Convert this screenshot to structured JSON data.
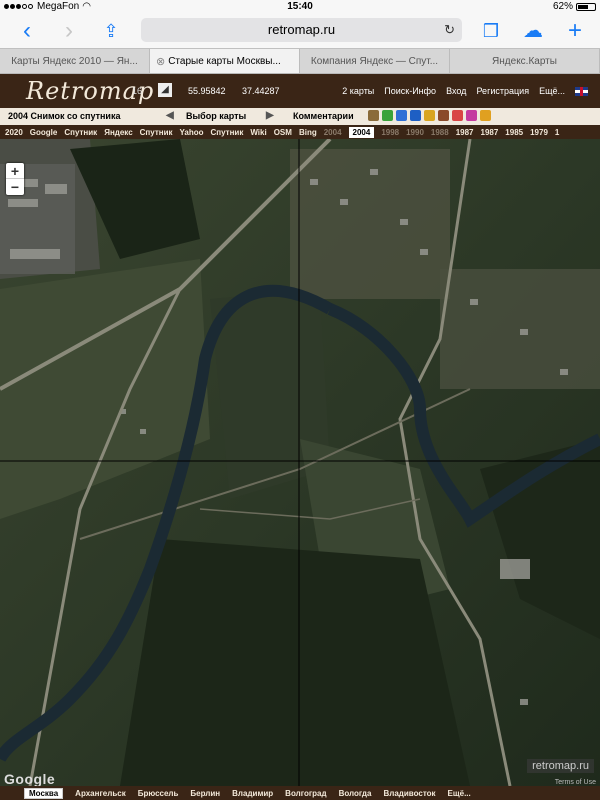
{
  "status": {
    "carrier": "MegaFon",
    "time": "15:40",
    "battery": "62%",
    "battery_level": 0.62
  },
  "browser": {
    "url": "retromap.ru",
    "tabs": [
      {
        "label": "Карты Яндекс 2010 — Ян..."
      },
      {
        "label": "Старые карты Москвы..."
      },
      {
        "label": "Компания Яндекс — Спут..."
      },
      {
        "label": "Яндекс.Карты"
      }
    ]
  },
  "header": {
    "logo": "Retromap",
    "zoom": "16",
    "lat": "55.95842",
    "lon": "37.44287",
    "menu": [
      "2 карты",
      "Поиск-Инфо",
      "Вход",
      "Регистрация",
      "Ещё..."
    ]
  },
  "info_bar": {
    "snapshot": "2004 Снимок со спутника",
    "select_map": "Выбор карты",
    "comments": "Комментарии",
    "icon_colors": [
      "#8a6b3a",
      "#3aa33a",
      "#2f6fd6",
      "#1e5fc4",
      "#d9a520",
      "#8a4a2a",
      "#d94545",
      "#c43aa0",
      "#e0a020"
    ]
  },
  "sources": [
    {
      "label": "2020",
      "state": "normal"
    },
    {
      "label": "Google",
      "state": "normal"
    },
    {
      "label": "Спутник",
      "state": "normal"
    },
    {
      "label": "Яндекс",
      "state": "normal"
    },
    {
      "label": "Спутник",
      "state": "normal"
    },
    {
      "label": "Yahoo",
      "state": "normal"
    },
    {
      "label": "Спутник",
      "state": "normal"
    },
    {
      "label": "Wiki",
      "state": "normal"
    },
    {
      "label": "OSM",
      "state": "normal"
    },
    {
      "label": "Bing",
      "state": "normal"
    },
    {
      "label": "2004",
      "state": "dim"
    },
    {
      "label": "2004",
      "state": "selected"
    },
    {
      "label": "1998",
      "state": "dim"
    },
    {
      "label": "1990",
      "state": "dim"
    },
    {
      "label": "1988",
      "state": "dim"
    },
    {
      "label": "1987",
      "state": "normal"
    },
    {
      "label": "1987",
      "state": "normal"
    },
    {
      "label": "1985",
      "state": "normal"
    },
    {
      "label": "1979",
      "state": "normal"
    },
    {
      "label": "1",
      "state": "normal"
    }
  ],
  "map": {
    "zoom_in": "+",
    "zoom_out": "−",
    "google": "Google",
    "watermark": "retromap.ru",
    "terms": "Terms of Use"
  },
  "cities": [
    {
      "label": "Москва",
      "selected": true
    },
    {
      "label": "Архангельск",
      "selected": false
    },
    {
      "label": "Брюссель",
      "selected": false
    },
    {
      "label": "Берлин",
      "selected": false
    },
    {
      "label": "Владимир",
      "selected": false
    },
    {
      "label": "Волгоград",
      "selected": false
    },
    {
      "label": "Вологда",
      "selected": false
    },
    {
      "label": "Владивосток",
      "selected": false
    },
    {
      "label": "Ещё...",
      "selected": false
    }
  ]
}
